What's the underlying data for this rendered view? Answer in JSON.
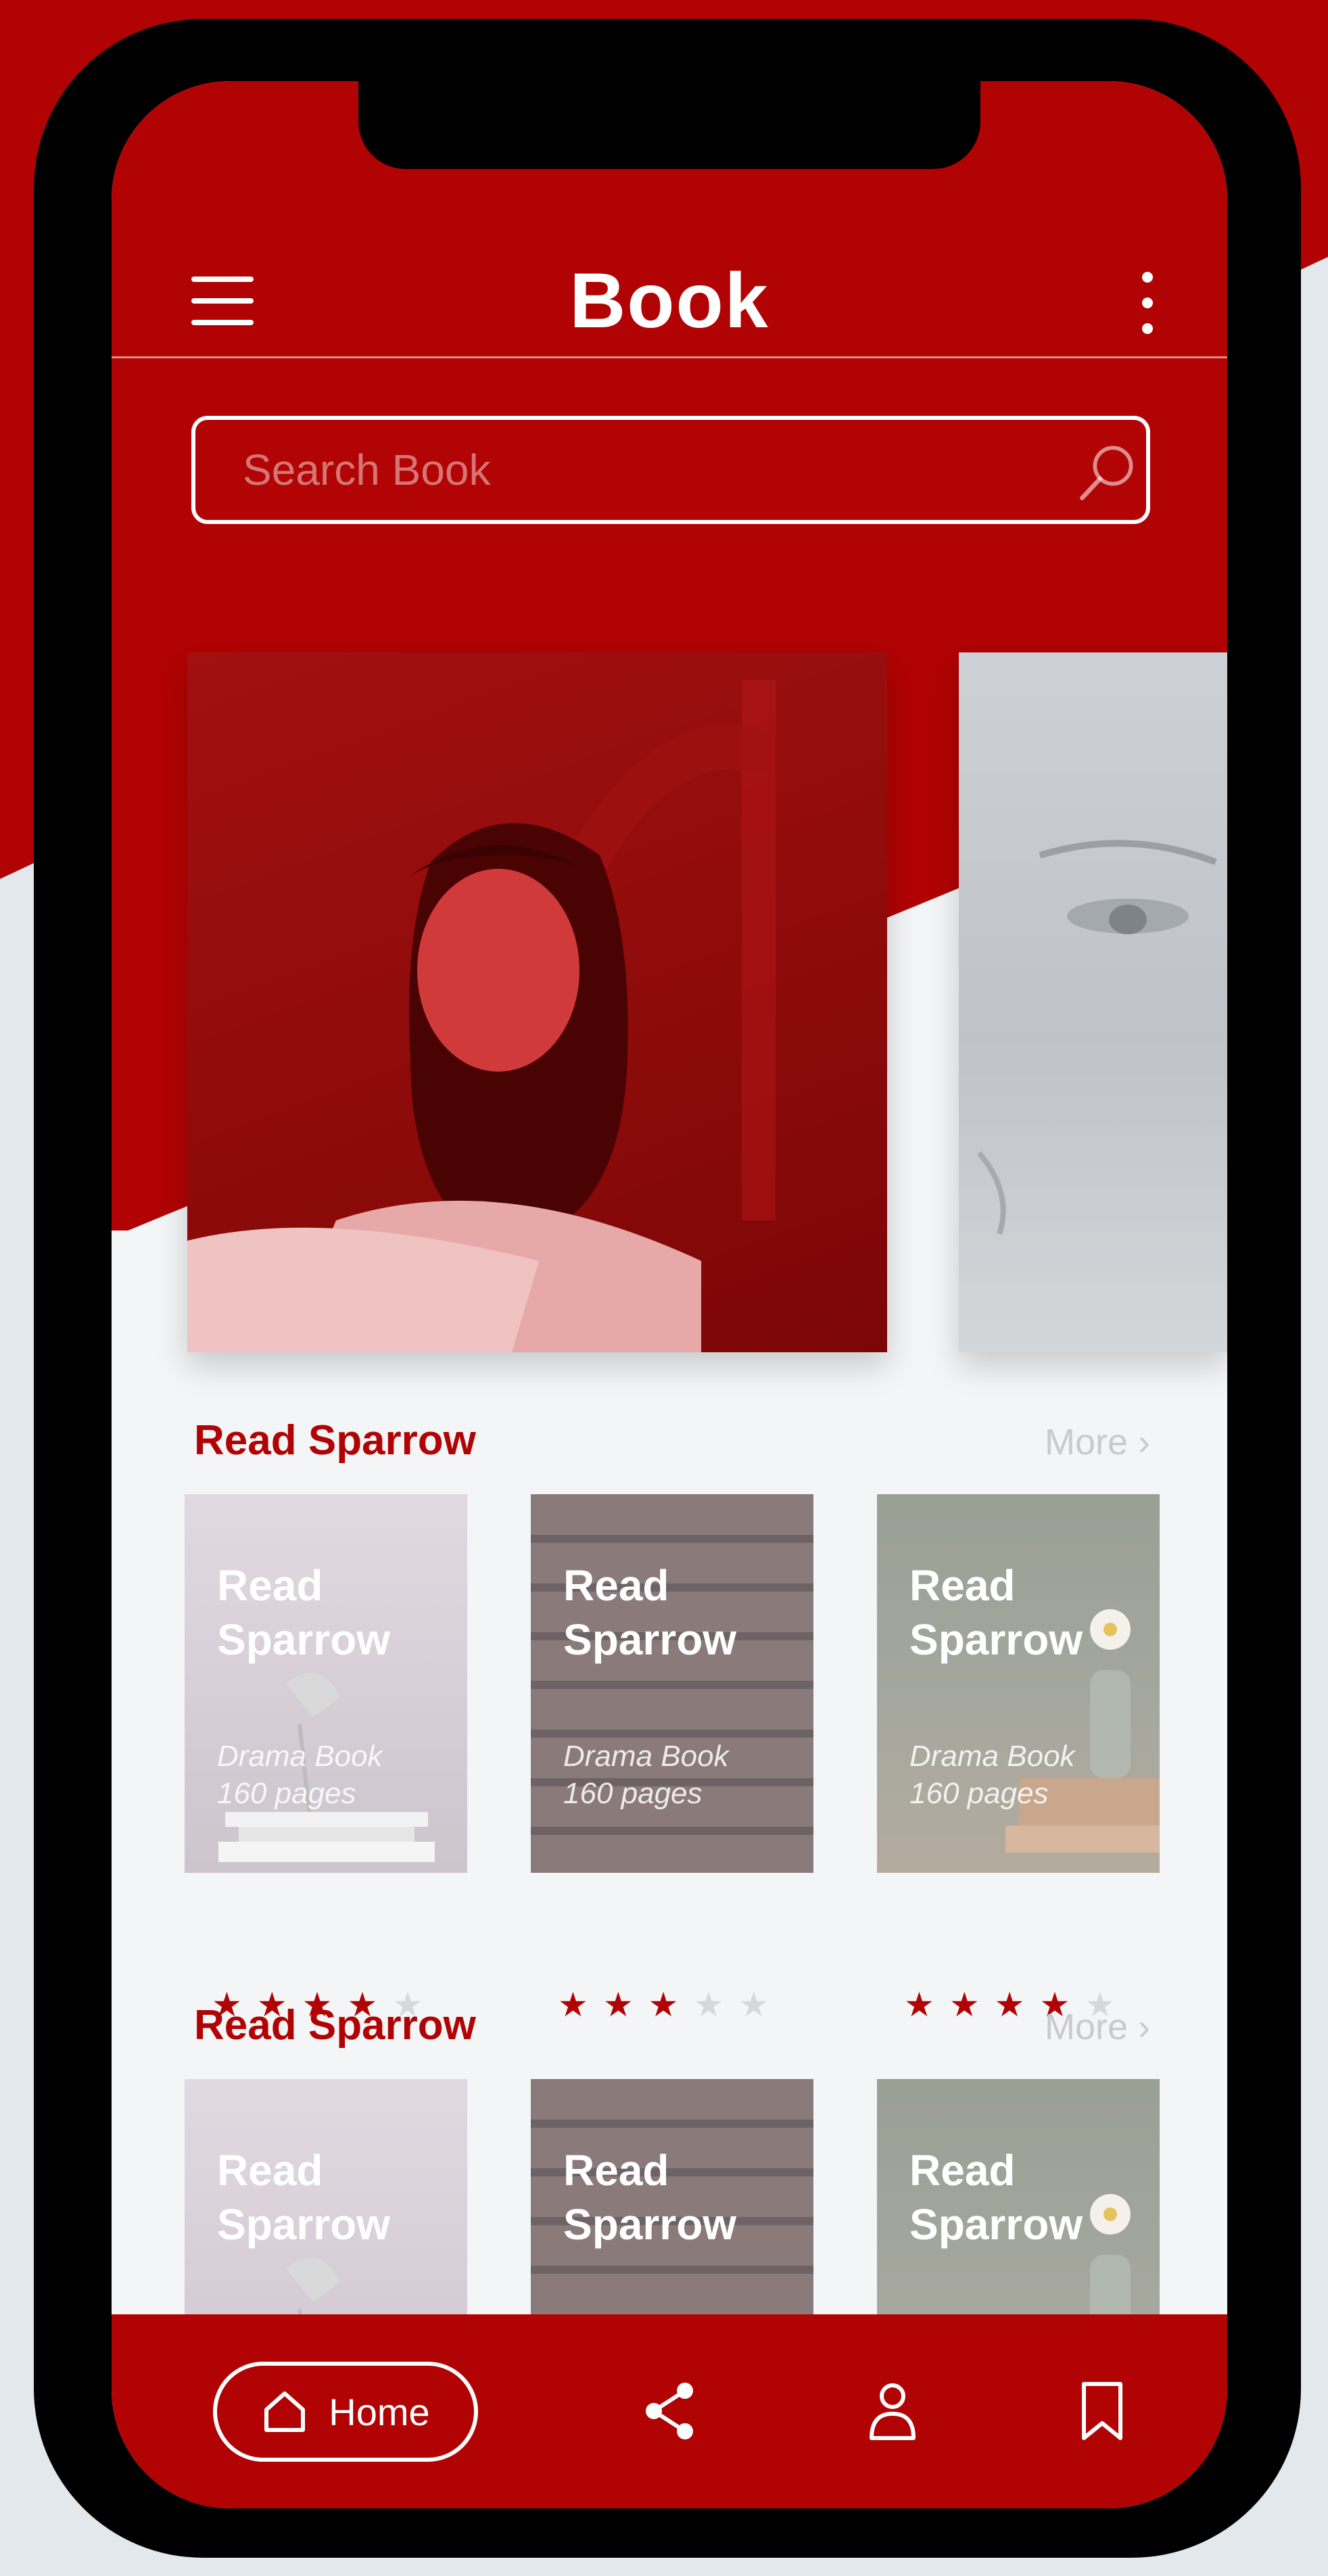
{
  "header": {
    "title": "Book"
  },
  "search": {
    "placeholder": "Search Book",
    "value": ""
  },
  "sections": [
    {
      "title": "Read Sparrow",
      "more_label": "More ›",
      "books": [
        {
          "title": "Read Sparrow",
          "genre": "Drama Book",
          "pages": "160 pages",
          "rating": 4
        },
        {
          "title": "Read Sparrow",
          "genre": "Drama Book",
          "pages": "160 pages",
          "rating": 3
        },
        {
          "title": "Read Sparrow",
          "genre": "Drama Book",
          "pages": "160 pages",
          "rating": 4
        }
      ]
    },
    {
      "title": "Read Sparrow",
      "more_label": "More ›",
      "books": [
        {
          "title": "Read Sparrow"
        },
        {
          "title": "Read Sparrow"
        },
        {
          "title": "Read Sparrow"
        }
      ]
    }
  ],
  "bottom_nav": {
    "home_label": "Home",
    "icons": [
      "home-icon",
      "share-icon",
      "user-icon",
      "bookmark-icon"
    ]
  },
  "colors": {
    "brand_red": "#b10303",
    "background": "#f3f5f7",
    "star_off": "#d6d9dc"
  }
}
